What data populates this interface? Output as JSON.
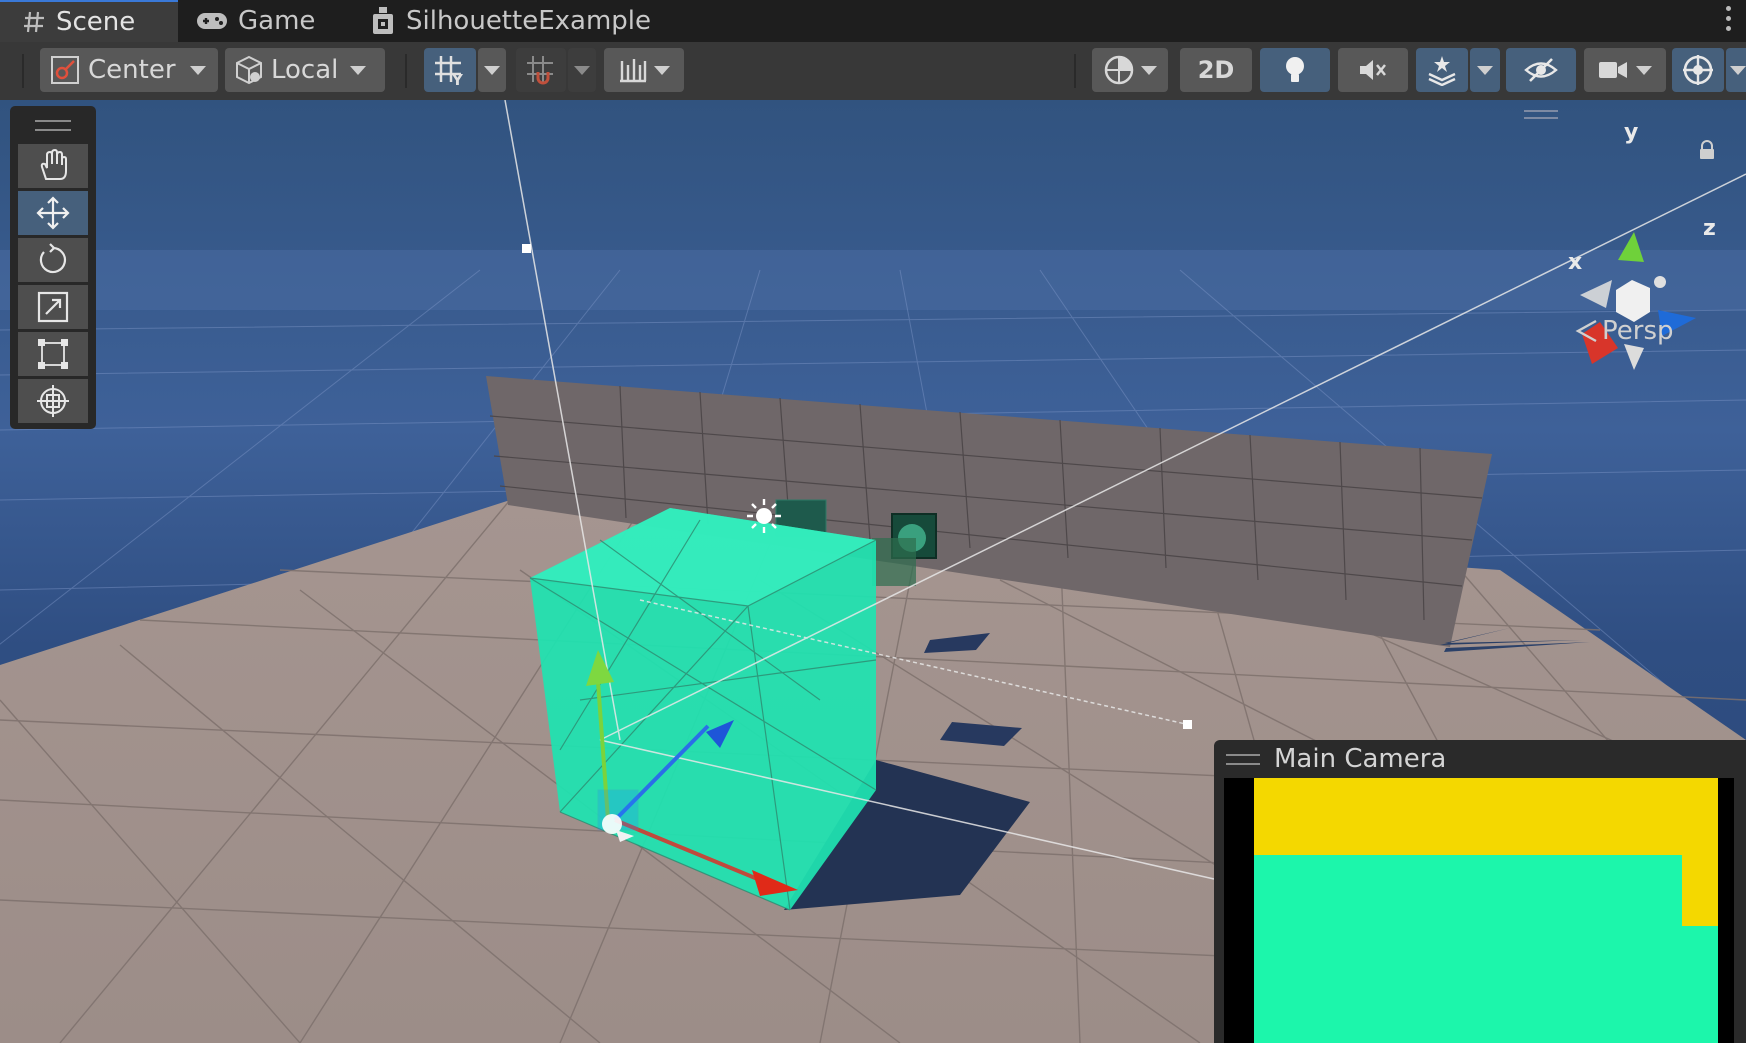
{
  "tabs": [
    {
      "label": "Scene",
      "icon": "hash-icon",
      "active": true
    },
    {
      "label": "Game",
      "icon": "gamepad-icon",
      "active": false
    },
    {
      "label": "SilhouetteExample",
      "icon": "prefab-icon",
      "active": false
    }
  ],
  "toolbar": {
    "pivot_label": "Center",
    "space_label": "Local",
    "mode_2d_label": "2D"
  },
  "tools": [
    "hand-icon",
    "move-icon",
    "rotate-icon",
    "scale-icon",
    "rect-icon",
    "transform-icon"
  ],
  "active_tool": "move-icon",
  "gizmo": {
    "y": "y",
    "x": "x",
    "z": "z",
    "projection": "Persp"
  },
  "camera_preview": {
    "title": "Main Camera"
  },
  "colors": {
    "selection_cube": "#1fe3b0",
    "preview_background": "#f4d800",
    "preview_silhouette": "#1cf6ab",
    "accent": "#46607c"
  }
}
